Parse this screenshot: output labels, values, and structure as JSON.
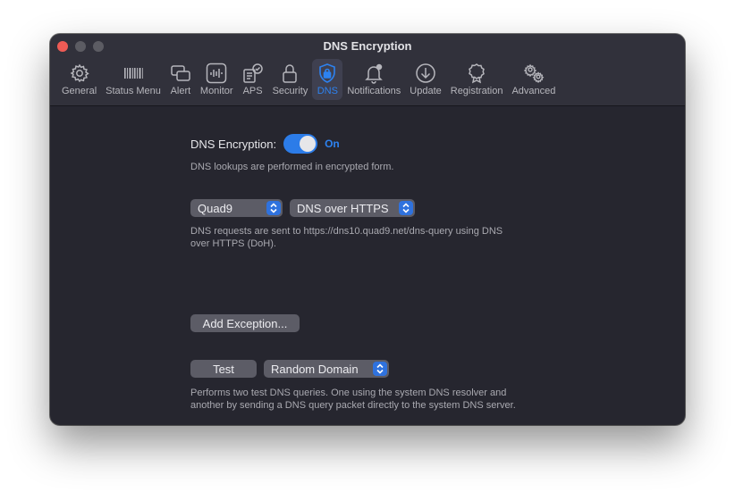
{
  "window": {
    "title": "DNS Encryption"
  },
  "toolbar": {
    "items": [
      {
        "label": "General",
        "icon": "gear-icon"
      },
      {
        "label": "Status Menu",
        "icon": "status-menu-icon"
      },
      {
        "label": "Alert",
        "icon": "alert-icon"
      },
      {
        "label": "Monitor",
        "icon": "monitor-icon"
      },
      {
        "label": "APS",
        "icon": "aps-icon"
      },
      {
        "label": "Security",
        "icon": "lock-icon"
      },
      {
        "label": "DNS",
        "icon": "dns-shield-icon"
      },
      {
        "label": "Notifications",
        "icon": "bell-icon"
      },
      {
        "label": "Update",
        "icon": "download-icon"
      },
      {
        "label": "Registration",
        "icon": "badge-icon"
      },
      {
        "label": "Advanced",
        "icon": "gears-icon"
      }
    ],
    "selected": "DNS"
  },
  "encryption": {
    "label": "DNS Encryption:",
    "toggle_state": "On",
    "description": "DNS lookups are performed in encrypted form."
  },
  "provider": {
    "server": "Quad9",
    "protocol": "DNS over HTTPS",
    "description_line1": "DNS requests are sent to https://dns10.quad9.net/dns-query using DNS",
    "description_line2": "over HTTPS (DoH)."
  },
  "exception": {
    "button_label": "Add Exception..."
  },
  "test": {
    "button_label": "Test",
    "mode": "Random Domain",
    "description_line1": "Performs two test DNS queries. One using the system DNS resolver and",
    "description_line2": "another by sending a DNS query packet directly to the system DNS server."
  },
  "colors": {
    "accent": "#2d82f0",
    "window_bg": "#26262f",
    "toolbar_bg": "#31313b"
  }
}
